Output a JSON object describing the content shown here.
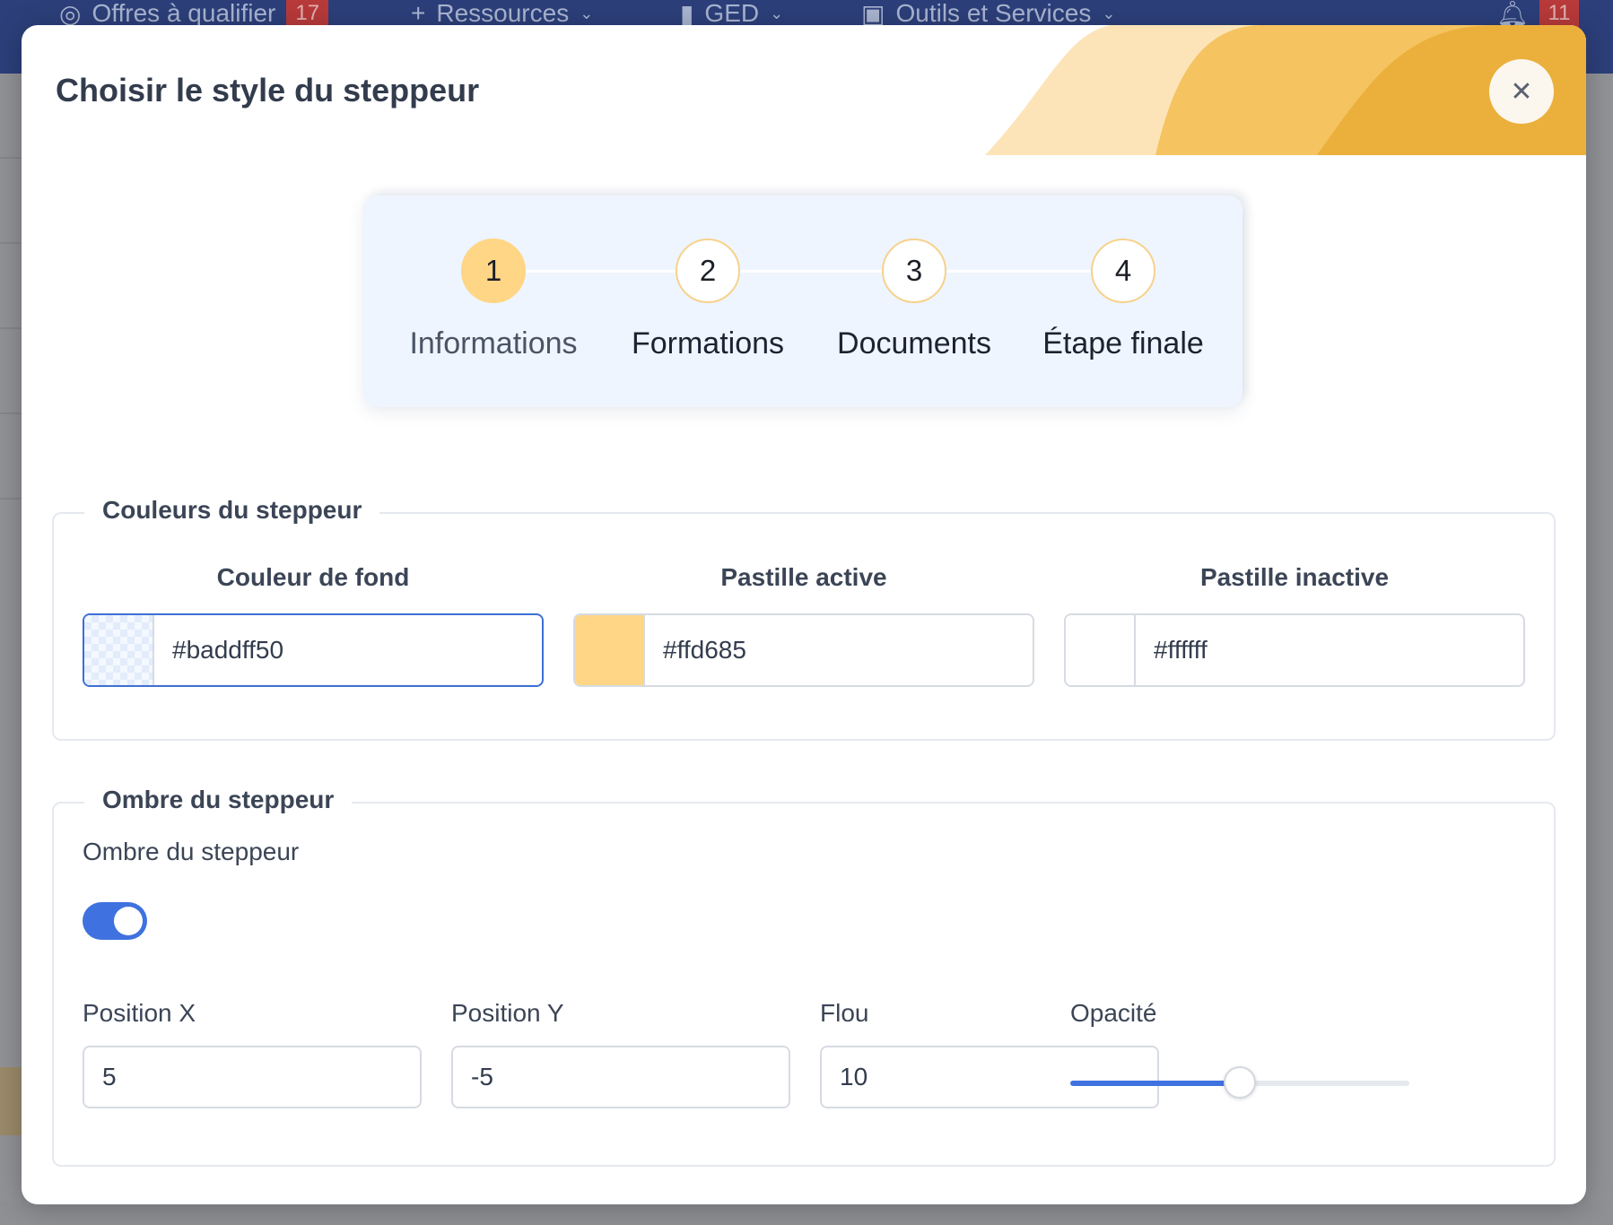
{
  "background_nav": {
    "items": [
      {
        "icon": "target-icon",
        "label": "Offres à qualifier",
        "badge": "17"
      },
      {
        "icon": "plus-icon",
        "label": "Ressources"
      },
      {
        "icon": "file-icon",
        "label": "GED"
      },
      {
        "icon": "briefcase-icon",
        "label": "Outils et Services"
      }
    ],
    "notifications_badge": "11"
  },
  "modal": {
    "title": "Choisir le style du steppeur",
    "close_icon": "close-icon"
  },
  "stepper_preview": {
    "steps": [
      {
        "number": "1",
        "label": "Informations",
        "active": true
      },
      {
        "number": "2",
        "label": "Formations",
        "active": false
      },
      {
        "number": "3",
        "label": "Documents",
        "active": false
      },
      {
        "number": "4",
        "label": "Étape finale",
        "active": false
      }
    ]
  },
  "colors_section": {
    "legend": "Couleurs du steppeur",
    "background": {
      "label": "Couleur de fond",
      "value": "#baddff50"
    },
    "active": {
      "label": "Pastille active",
      "value": "#ffd685"
    },
    "inactive": {
      "label": "Pastille inactive",
      "value": "#ffffff"
    }
  },
  "shadow_section": {
    "legend": "Ombre du steppeur",
    "toggle_label": "Ombre du steppeur",
    "toggle_on": true,
    "position_x": {
      "label": "Position X",
      "value": "5"
    },
    "position_y": {
      "label": "Position Y",
      "value": "-5"
    },
    "blur": {
      "label": "Flou",
      "value": "10"
    },
    "opacity": {
      "label": "Opacité",
      "value": 0.5
    }
  },
  "accent_colors": {
    "primary": "#3f72e0",
    "header_gold": "#f2b84b"
  }
}
